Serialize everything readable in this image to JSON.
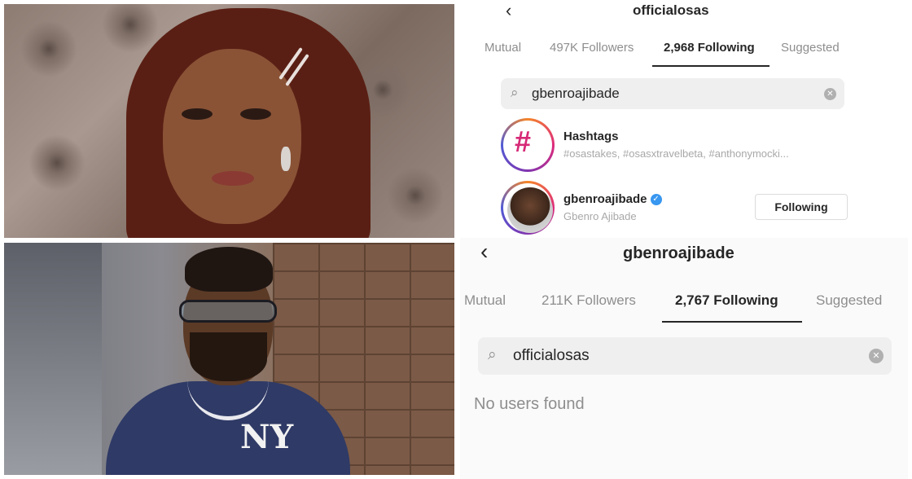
{
  "top_profile": {
    "back_icon": "chevron-left-icon",
    "username": "officialosas",
    "tabs": [
      {
        "label": "Mutual",
        "active": false
      },
      {
        "label": "497K Followers",
        "active": false
      },
      {
        "label": "2,968 Following",
        "active": true
      },
      {
        "label": "Suggested",
        "active": false
      }
    ],
    "search": {
      "icon": "search-icon",
      "query": "gbenroajibade",
      "clear_icon": "clear-icon"
    },
    "results": [
      {
        "type": "hashtags",
        "title": "Hashtags",
        "subtitle": "#osastakes, #osasxtravelbeta, #anthonymocki..."
      },
      {
        "type": "user",
        "title": "gbenroajibade",
        "verified": true,
        "subtitle": "Gbenro Ajibade",
        "button": "Following"
      }
    ]
  },
  "bottom_profile": {
    "back_icon": "chevron-left-icon",
    "username": "gbenroajibade",
    "tabs": [
      {
        "label": "Mutual",
        "active": false
      },
      {
        "label": "211K Followers",
        "active": false
      },
      {
        "label": "2,767 Following",
        "active": true
      },
      {
        "label": "Suggested",
        "active": false
      }
    ],
    "search": {
      "icon": "search-icon",
      "query": "officialosas",
      "clear_icon": "clear-icon"
    },
    "empty_message": "No users found"
  },
  "photo_text": {
    "shirt_print": "NY"
  },
  "colors": {
    "accent_blue": "#3897f0",
    "text_primary": "#262626",
    "text_secondary": "#8e8e8e"
  }
}
